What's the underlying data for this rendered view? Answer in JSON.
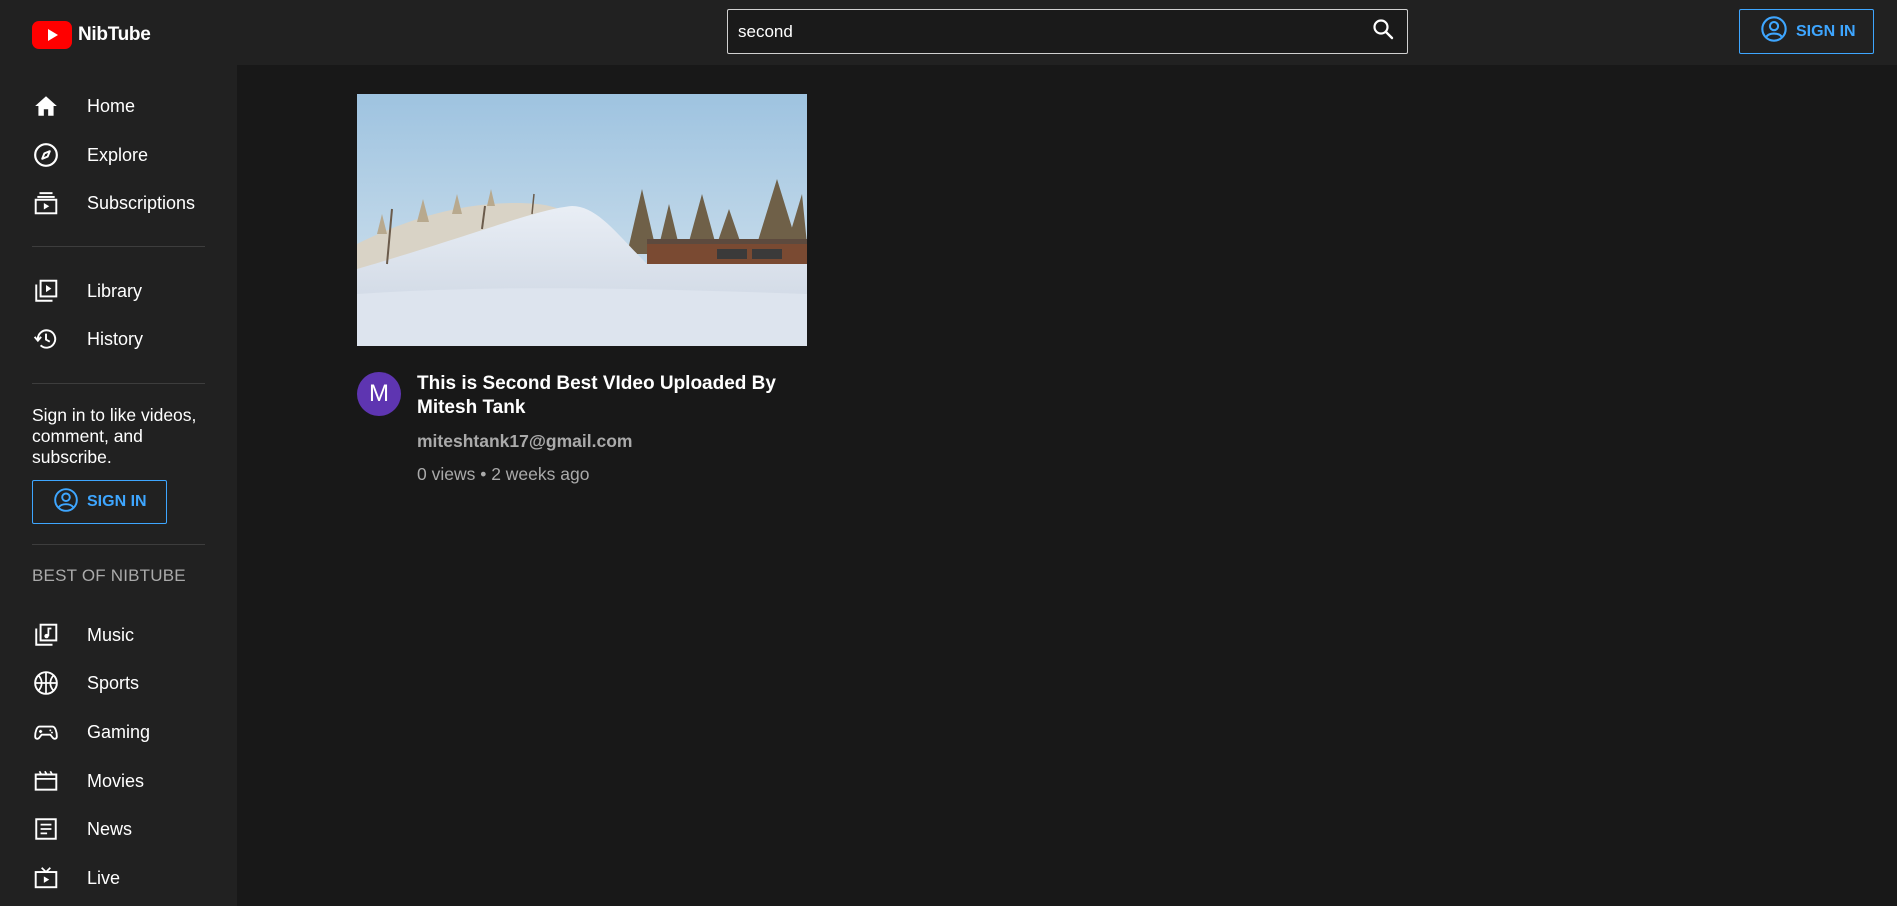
{
  "app": {
    "name": "NibTube"
  },
  "search": {
    "value": "second",
    "icon": "search-icon"
  },
  "header": {
    "sign_in_label": "SIGN IN"
  },
  "sidebar": {
    "primary": [
      {
        "label": "Home",
        "icon": "home-icon"
      },
      {
        "label": "Explore",
        "icon": "compass-icon"
      },
      {
        "label": "Subscriptions",
        "icon": "subscriptions-icon"
      }
    ],
    "secondary": [
      {
        "label": "Library",
        "icon": "library-icon"
      },
      {
        "label": "History",
        "icon": "history-icon"
      }
    ],
    "signin_prompt": "Sign in to like videos, comment, and subscribe.",
    "sign_in_label": "SIGN IN",
    "section_title": "BEST OF NIBTUBE",
    "best_of": [
      {
        "label": "Music",
        "icon": "music-icon"
      },
      {
        "label": "Sports",
        "icon": "sports-icon"
      },
      {
        "label": "Gaming",
        "icon": "gaming-icon"
      },
      {
        "label": "Movies",
        "icon": "movies-icon"
      },
      {
        "label": "News",
        "icon": "news-icon"
      },
      {
        "label": "Live",
        "icon": "live-icon"
      }
    ]
  },
  "results": [
    {
      "title": "This is Second Best VIdeo Uploaded By Mitesh Tank",
      "channel": "miteshtank17@gmail.com",
      "meta": "0 views • 2 weeks ago",
      "avatar_letter": "M",
      "avatar_color": "#5e35b1"
    }
  ],
  "colors": {
    "accent": "#3ea6ff",
    "brand": "#ff0000",
    "background": "#181818",
    "surface": "#212121"
  }
}
